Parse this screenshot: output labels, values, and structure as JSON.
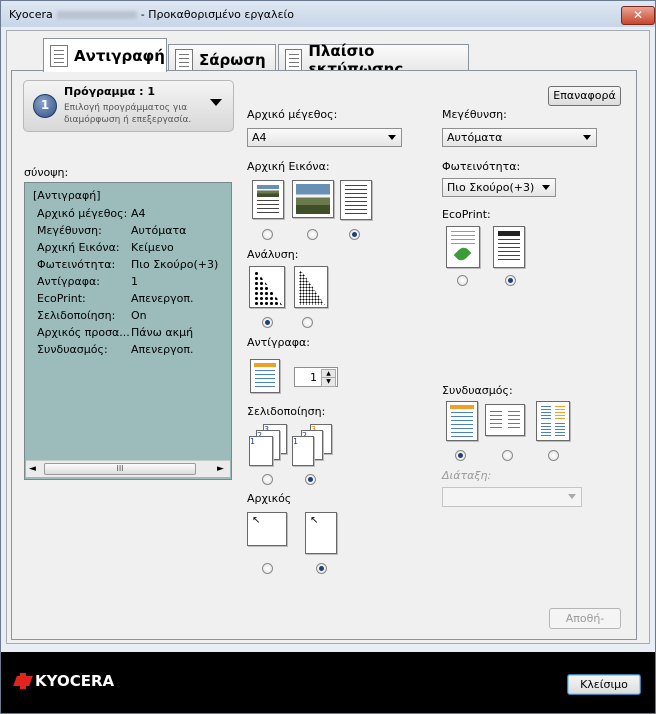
{
  "window": {
    "title_prefix": "Kyocera",
    "title_suffix": "- Προκαθορισμένο εργαλείο",
    "close_glyph": "✕"
  },
  "tabs": [
    {
      "label": "Αντιγραφή",
      "active": true
    },
    {
      "label": "Σάρωση",
      "active": false
    },
    {
      "label": "Πλαίσιο εκτύπωσης",
      "active": false
    }
  ],
  "program": {
    "number": "1",
    "title": "Πρόγραμμα : 1",
    "description": "Επιλογή προγράμματος για διαμόρφωση ή επεξεργασία."
  },
  "reset_button": "Επαναφορά",
  "summary": {
    "label": "σύνοψη:",
    "heading": "[Αντιγραφή]",
    "rows": [
      {
        "key": "Αρχικό μέγεθος:",
        "value": "A4"
      },
      {
        "key": "Μεγέθυνση:",
        "value": "Αυτόματα"
      },
      {
        "key": "Αρχική Εικόνα:",
        "value": "Κείμενο"
      },
      {
        "key": "Φωτεινότητα:",
        "value": "Πιο Σκούρο(+3)"
      },
      {
        "key": "Αντίγραφα:",
        "value": "1"
      },
      {
        "key": "EcoPrint:",
        "value": "Απενεργοπ."
      },
      {
        "key": "Σελιδοποίηση:",
        "value": "On"
      },
      {
        "key": "Αρχικός προσα...",
        "value": "Πάνω ακμή"
      },
      {
        "key": "Συνδυασμός:",
        "value": "Απενεργοπ."
      }
    ],
    "scroll_left": "◄",
    "scroll_thumb": "III",
    "scroll_right": "►"
  },
  "original_size": {
    "label": "Αρχικό μέγεθος:",
    "value": "A4"
  },
  "original_image": {
    "label": "Αρχική Εικόνα:",
    "selected_index": 2
  },
  "resolution": {
    "label": "Ανάλυση:",
    "selected_index": 0
  },
  "copies": {
    "label": "Αντίγραφα:",
    "value": "1",
    "up": "▲",
    "down": "▼"
  },
  "collate": {
    "label": "Σελιδοποίηση:",
    "selected_index": 1,
    "pages_a": [
      "1",
      "2",
      "3"
    ],
    "pages_b": [
      "1",
      "2",
      "3"
    ]
  },
  "orientation": {
    "label": "Αρχικός",
    "selected_index": 1
  },
  "zoom": {
    "label": "Μεγέθυνση:",
    "value": "Αυτόματα"
  },
  "density": {
    "label": "Φωτεινότητα:",
    "value": "Πιο Σκούρο(+3)"
  },
  "ecoprint": {
    "label": "EcoPrint:",
    "selected_index": 1
  },
  "combine": {
    "label": "Συνδυασμός:",
    "selected_index": 0
  },
  "layout": {
    "label": "Διάταξη:",
    "value": ""
  },
  "save_button": "Αποθή-",
  "close_button": "Κλείσιμο",
  "brand": "KYOCERA",
  "colors": {
    "accent_blue": "#1e3f7a",
    "summary_bg": "#9cbcbc",
    "brand_red": "#e1251b"
  }
}
